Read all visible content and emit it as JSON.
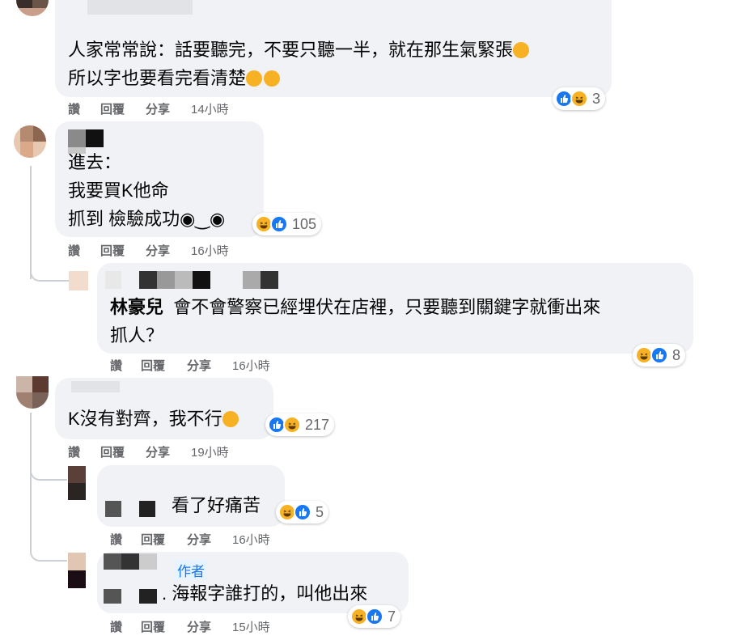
{
  "comments": [
    {
      "id": "c1",
      "name": "",
      "lines": [
        "人家常常說：話要聽完，不要只聽一半，就在那生氣緊張",
        "所以字也要看完看清楚"
      ],
      "line_emojis": [
        "rofl-emoji",
        "laugh-emoji laugh-emoji"
      ],
      "reaction_count": "3",
      "reaction_icons": [
        "like-icon",
        "haha-icon"
      ],
      "time": "14小時"
    },
    {
      "id": "c2",
      "name": "",
      "lines": [
        "進去：",
        "我要買K他命",
        "抓到 檢驗成功◉‿◉"
      ],
      "reaction_count": "105",
      "reaction_icons": [
        "haha-icon",
        "like-icon"
      ],
      "time": "16小時"
    },
    {
      "id": "c2r1",
      "name": "林豪兒",
      "lines": [
        "會不會警察已經埋伏在店裡，只要聽到關鍵字就衝出來",
        "抓人？"
      ],
      "reaction_count": "8",
      "reaction_icons": [
        "haha-icon",
        "like-icon"
      ],
      "time": "16小時"
    },
    {
      "id": "c3",
      "name": "",
      "lines": [
        "K沒有對齊，我不行"
      ],
      "reaction_count": "217",
      "reaction_icons": [
        "like-icon",
        "haha-icon"
      ],
      "time": "19小時"
    },
    {
      "id": "c3r1",
      "name": "",
      "lines": [
        "看了好痛苦"
      ],
      "reaction_count": "5",
      "reaction_icons": [
        "haha-icon",
        "like-icon"
      ],
      "time": "16小時"
    },
    {
      "id": "c3r2",
      "name": "",
      "author_badge": "作者",
      "lines": [
        ". 海報字誰打的，叫他出來"
      ],
      "reaction_count": "7",
      "reaction_icons": [
        "haha-icon",
        "like-icon"
      ],
      "time": "15小時"
    }
  ],
  "actions": {
    "like": "讚",
    "reply": "回覆",
    "share": "分享"
  },
  "colors": {
    "bubble": "#f0f2f5",
    "meta": "#65676b",
    "like": "#1877f2",
    "haha": "#f7b125",
    "author": "#1877f2"
  }
}
